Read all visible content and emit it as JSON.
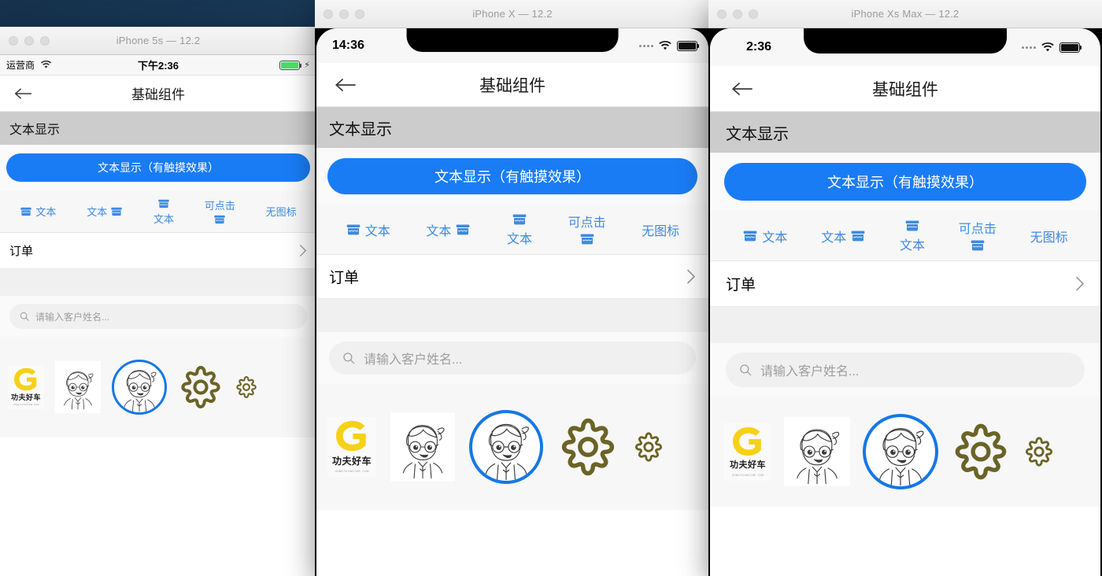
{
  "desktop": {
    "background": "#1d4e74"
  },
  "windows": [
    {
      "id": "iphone5s",
      "title": "iPhone 5s — 12.2",
      "status": {
        "carrier": "运营商",
        "time": "下午2:36",
        "wifi_icon": "wifi-icon",
        "battery_icon": "battery-icon",
        "charging_icon": "bolt-icon"
      },
      "nav": {
        "back_icon": "back-arrow-icon",
        "title": "基础组件"
      },
      "gray_row": {
        "label": "文本显示"
      },
      "button": {
        "label": "文本显示（有触摸效果）",
        "color": "#1a7cf5"
      },
      "icon_row": [
        {
          "label": "文本",
          "icon": "shop-icon",
          "layout": "icon-left"
        },
        {
          "label": "文本",
          "icon": "shop-icon",
          "layout": "icon-right"
        },
        {
          "label": "文本",
          "icon": "shop-icon",
          "layout": "icon-top"
        },
        {
          "label": "可点击",
          "icon": "shop-icon",
          "layout": "icon-bottom"
        },
        {
          "label": "无图标",
          "icon": "",
          "layout": "no-icon"
        }
      ],
      "list_row": {
        "label": "订单",
        "chevron": "chevron-right-icon"
      },
      "search": {
        "placeholder": "请输入客户姓名...",
        "icon": "search-icon"
      },
      "images": [
        {
          "name": "logo-gongfuhaoche",
          "cn": "功夫好车",
          "py": "GONG FU HAO CHE . COM"
        },
        {
          "name": "avatar-square"
        },
        {
          "name": "avatar-circle"
        },
        {
          "name": "gear-large",
          "color": "#6b6326"
        },
        {
          "name": "gear-small",
          "color": "#6b6326"
        }
      ]
    },
    {
      "id": "iphonex",
      "title": "iPhone X — 12.2",
      "status": {
        "time": "14:36",
        "signal_icon": "signal-dots-icon",
        "wifi_icon": "wifi-icon",
        "battery_icon": "battery-icon"
      },
      "nav": {
        "back_icon": "back-arrow-icon",
        "title": "基础组件"
      },
      "gray_row": {
        "label": "文本显示"
      },
      "button": {
        "label": "文本显示（有触摸效果）",
        "color": "#1a7cf5"
      },
      "icon_row": [
        {
          "label": "文本",
          "icon": "shop-icon",
          "layout": "icon-left"
        },
        {
          "label": "文本",
          "icon": "shop-icon",
          "layout": "icon-right"
        },
        {
          "label": "文本",
          "icon": "shop-icon",
          "layout": "icon-top"
        },
        {
          "label": "可点击",
          "icon": "shop-icon",
          "layout": "icon-bottom"
        },
        {
          "label": "无图标",
          "icon": "",
          "layout": "no-icon"
        }
      ],
      "list_row": {
        "label": "订单",
        "chevron": "chevron-right-icon"
      },
      "search": {
        "placeholder": "请输入客户姓名...",
        "icon": "search-icon"
      },
      "images": [
        {
          "name": "logo-gongfuhaoche",
          "cn": "功夫好车",
          "py": "GONG FU HAO CHE . COM"
        },
        {
          "name": "avatar-square"
        },
        {
          "name": "avatar-circle"
        },
        {
          "name": "gear-large",
          "color": "#6b6326"
        },
        {
          "name": "gear-small",
          "color": "#6b6326"
        }
      ]
    },
    {
      "id": "iphonexsmax",
      "title": "iPhone Xs Max — 12.2",
      "status": {
        "time": "2:36",
        "signal_icon": "signal-dots-icon",
        "wifi_icon": "wifi-icon",
        "battery_icon": "battery-icon"
      },
      "nav": {
        "back_icon": "back-arrow-icon",
        "title": "基础组件"
      },
      "gray_row": {
        "label": "文本显示"
      },
      "button": {
        "label": "文本显示（有触摸效果）",
        "color": "#1a7cf5"
      },
      "icon_row": [
        {
          "label": "文本",
          "icon": "shop-icon",
          "layout": "icon-left"
        },
        {
          "label": "文本",
          "icon": "shop-icon",
          "layout": "icon-right"
        },
        {
          "label": "文本",
          "icon": "shop-icon",
          "layout": "icon-top"
        },
        {
          "label": "可点击",
          "icon": "shop-icon",
          "layout": "icon-bottom"
        },
        {
          "label": "无图标",
          "icon": "",
          "layout": "no-icon"
        }
      ],
      "list_row": {
        "label": "订单",
        "chevron": "chevron-right-icon"
      },
      "search": {
        "placeholder": "请输入客户姓名...",
        "icon": "search-icon"
      },
      "images": [
        {
          "name": "logo-gongfuhaoche",
          "cn": "功夫好车",
          "py": "GONG FU HAO CHE . COM"
        },
        {
          "name": "avatar-square"
        },
        {
          "name": "avatar-circle"
        },
        {
          "name": "gear-large",
          "color": "#6b6326"
        },
        {
          "name": "gear-small",
          "color": "#6b6326"
        }
      ]
    }
  ]
}
